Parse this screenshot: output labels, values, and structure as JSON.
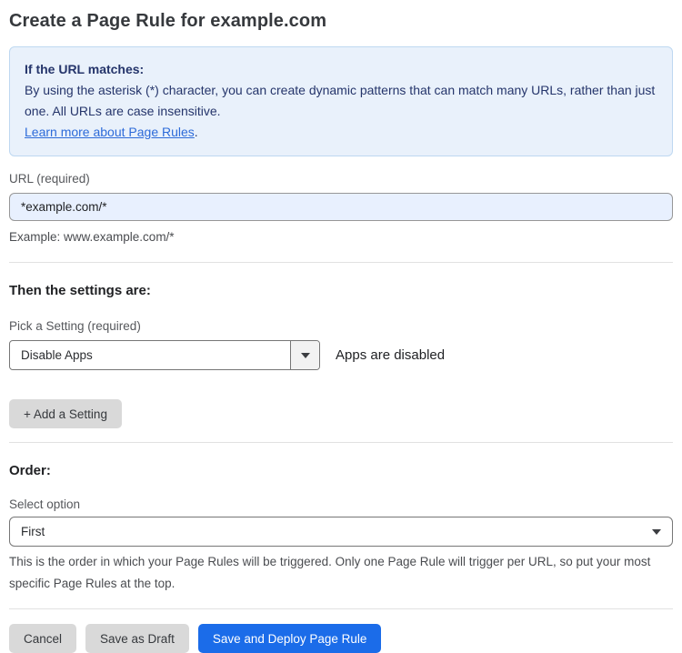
{
  "page": {
    "title": "Create a Page Rule for example.com"
  },
  "callout": {
    "heading": "If the URL matches:",
    "body_line": "By using the asterisk (*) character, you can create dynamic patterns that can match many URLs, rather than just one. All URLs are case insensitive.",
    "link_label": "Learn more about Page Rules",
    "link_suffix": "."
  },
  "url_field": {
    "label": "URL (required)",
    "value": "*example.com/*",
    "helper": "Example: www.example.com/*"
  },
  "settings_section": {
    "heading": "Then the settings are:",
    "picker_label": "Pick a Setting (required)",
    "picker_value": "Disable Apps",
    "status_text": "Apps are disabled",
    "add_button_label": "+ Add a Setting"
  },
  "order_section": {
    "heading": "Order:",
    "select_label": "Select option",
    "select_value": "First",
    "helper": "This is the order in which your Page Rules will be triggered. Only one Page Rule will trigger per URL, so put your most specific Page Rules at the top."
  },
  "footer": {
    "cancel_label": "Cancel",
    "save_draft_label": "Save as Draft",
    "save_deploy_label": "Save and Deploy Page Rule"
  },
  "colors": {
    "primary_button": "#1b6ce9",
    "secondary_button": "#d9d9d9",
    "callout_background": "#e9f1fb",
    "callout_text": "#25356b",
    "link": "#2d6bd9",
    "input_background": "#e8f0fe"
  }
}
